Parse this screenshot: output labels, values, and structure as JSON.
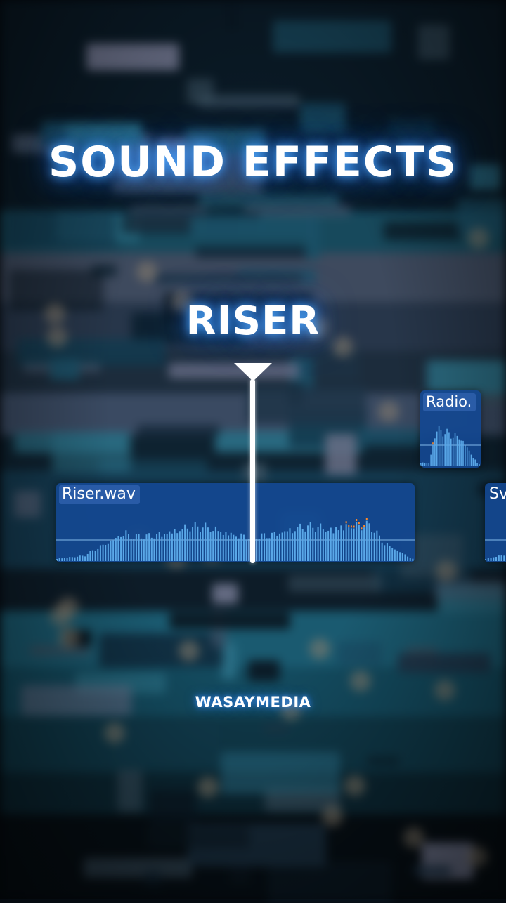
{
  "title": "SOUND EFFECTS",
  "subtitle": "RISER",
  "watermark": "WASAYMEDIA",
  "clips": [
    {
      "label": "Riser.wav"
    },
    {
      "label": "Radio."
    },
    {
      "label": "Sv"
    }
  ],
  "colors": {
    "clip_fill": "#14489a",
    "waveform": "#5aa8e8",
    "peak": "#ff8a2a",
    "glow": "#3c8cff",
    "background": "#05090f"
  }
}
